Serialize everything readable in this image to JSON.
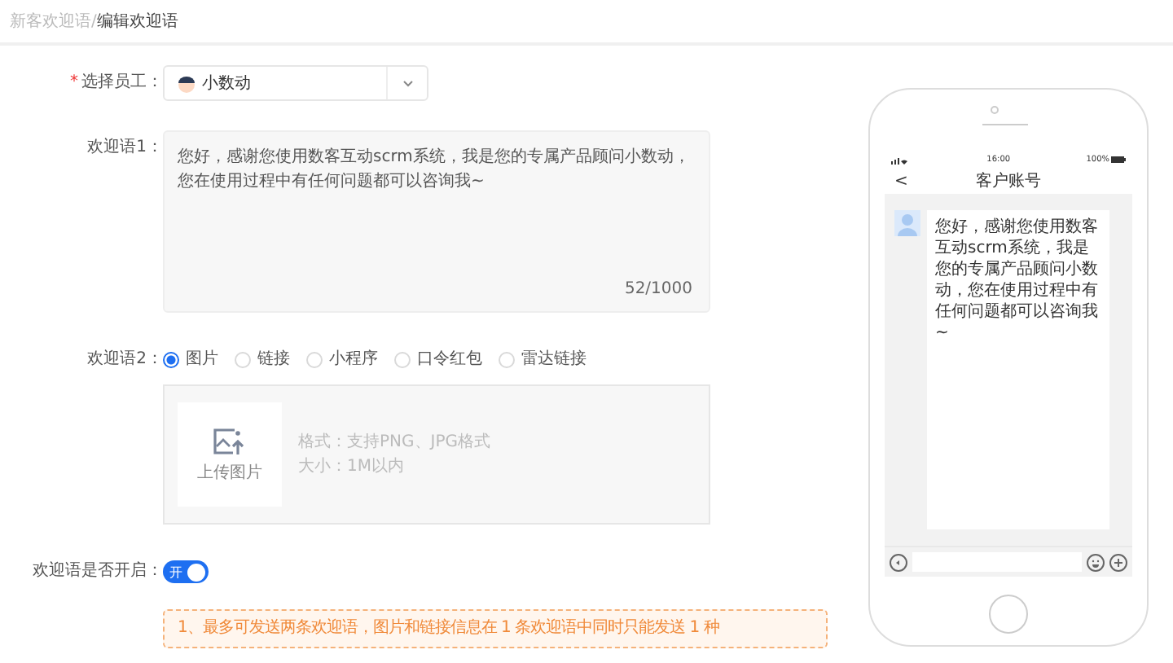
{
  "breadcrumb_separator": "/",
  "breadcrumb": [
    {
      "label": "新客欢迎语",
      "current": false
    },
    {
      "label": "编辑欢迎语",
      "current": true
    }
  ],
  "employee": {
    "label": "选择员工：",
    "required": true,
    "required_mark": "*",
    "value": "小数动"
  },
  "welcome1": {
    "label": "欢迎语1：",
    "value": "您好，感谢您使用数客互动scrm系统，我是您的专属产品顾问小数动，您在使用过程中有任何问题都可以咨询我~",
    "counter": "52/1000"
  },
  "welcome2": {
    "label": "欢迎语2：",
    "options": [
      {
        "label": "图片",
        "selected": true
      },
      {
        "label": "链接",
        "selected": false
      },
      {
        "label": "小程序",
        "selected": false
      },
      {
        "label": "口令红包",
        "selected": false
      },
      {
        "label": "雷达链接",
        "selected": false
      }
    ],
    "upload": {
      "button": "上传图片",
      "hints": [
        "格式：支持PNG、JPG格式",
        "大小：1M以内"
      ]
    }
  },
  "enable": {
    "label": "欢迎语是否开启：",
    "on": true,
    "text": "开"
  },
  "tips": [
    "1、最多可发送两条欢迎语，图片和链接信息在 1 条欢迎语中同时只能发送 1 种"
  ],
  "phone": {
    "time": "16:00",
    "battery": "100%",
    "title": "客户账号",
    "back": "<",
    "message": "您好，感谢您使用数客互动scrm系统，我是您的专属产品顾问小数动，您在使用过程中有任何问题都可以咨询我~"
  }
}
